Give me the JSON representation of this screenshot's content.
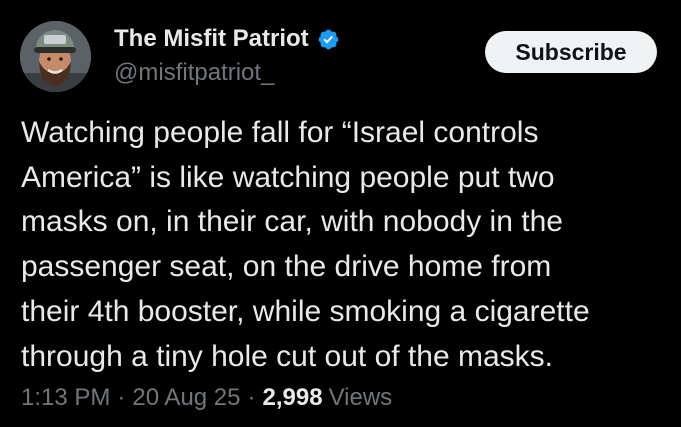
{
  "tweet": {
    "author": {
      "display_name": "The Misfit Patriot",
      "handle": "@misfitpatriot_",
      "verified": true,
      "verified_icon": "verified-badge-icon",
      "avatar_icon": "avatar-photo"
    },
    "subscribe_label": "Subscribe",
    "text": "Watching people fall for “Israel controls\nAmerica” is like watching people put two\nmasks on, in their car, with nobody in the\npassenger seat, on the drive home from\ntheir 4th booster, while smoking a cigarette\nthrough a tiny hole cut out of the masks.",
    "meta": {
      "time": "1:13 PM",
      "separator": "·",
      "date": "20 Aug 25",
      "views_count": "2,998",
      "views_label": "Views"
    }
  },
  "colors": {
    "background": "#000000",
    "primary_text": "#e7e9ea",
    "secondary_text": "#71767b",
    "verified_blue": "#1d9bf0",
    "button_bg": "#eff3f4",
    "button_text": "#0f1419"
  }
}
